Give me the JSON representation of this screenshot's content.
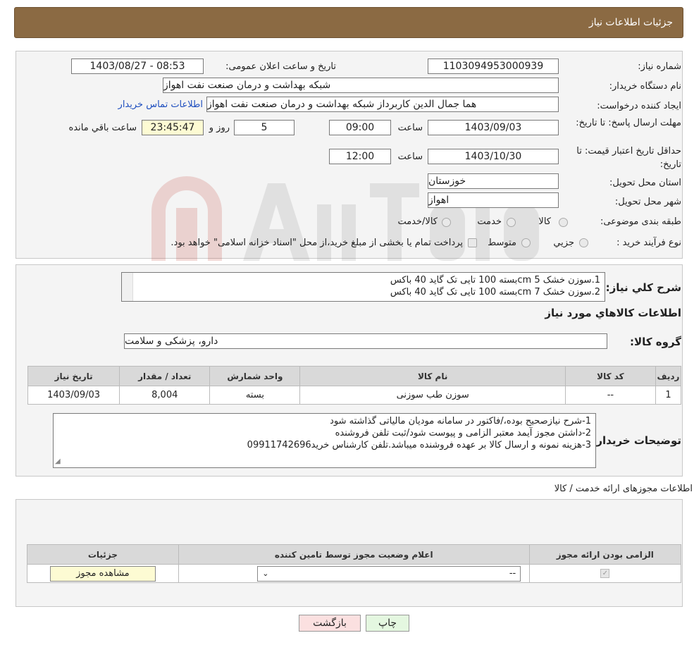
{
  "header": {
    "title": "جزئیات اطلاعات نیاز"
  },
  "info": {
    "need_number_label": "شماره نیاز:",
    "need_number": "1103094953000939",
    "announce_label": "تاریخ و ساعت اعلان عمومی:",
    "announce_value": "1403/08/27 - 08:53",
    "buyer_org_label": "نام دستگاه خریدار:",
    "buyer_org": "شبکه بهداشت و درمان صنعت نفت اهواز",
    "creator_label": "ایجاد کننده درخواست:",
    "creator": "هما جمال الدین کاربرداز شبکه بهداشت و درمان صنعت نفت اهواز",
    "contact_link": "اطلاعات تماس خریدار",
    "deadline_label": "مهلت ارسال پاسخ: تا تاریخ:",
    "deadline_date": "1403/09/03",
    "time_label": "ساعت",
    "deadline_time": "09:00",
    "days": "5",
    "days_label": "روز و",
    "remaining": "23:45:47",
    "remaining_label": "ساعت باقي مانده",
    "price_valid_label": "حداقل تاریخ اعتبار قیمت: تا تاریخ:",
    "price_valid_date": "1403/10/30",
    "price_valid_time": "12:00",
    "province_label": "استان محل تحویل:",
    "province": "خوزستان",
    "city_label": "شهر محل تحویل:",
    "city": "اهواز",
    "category_label": "طبقه بندی موضوعی:",
    "category_options": [
      "کالا",
      "خدمت",
      "کالا/خدمت"
    ],
    "process_label": "نوع فرآیند خرید :",
    "process_options": [
      "جزيي",
      "متوسط"
    ],
    "process_note": "پرداخت تمام یا بخشی از مبلغ خرید،از محل \"اسناد خزانه اسلامی\" خواهد بود."
  },
  "summary": {
    "label": "شرح کلي نياز:",
    "lines": [
      "1.سوزن خشک 5 cmبسته  100 تایی تک گاید 40 باکس",
      "2.سوزن خشک 7 cmبسته  100 تایی تک گاید 40 باکس"
    ],
    "goods_title": "اطلاعات کالاهاي مورد نياز",
    "group_label": "گروه کالا:",
    "group_value": "دارو، پزشکی و سلامت"
  },
  "goods_table": {
    "headers": [
      "رديف",
      "کد کالا",
      "نام کالا",
      "واحد شمارش",
      "تعداد / مقدار",
      "تاریخ نیاز"
    ],
    "rows": [
      [
        "1",
        "--",
        "سوزن طب سوزنی",
        "بسته",
        "8,004",
        "1403/09/03"
      ]
    ]
  },
  "buyer_notes": {
    "label": "توضیحات خریدار:",
    "lines": [
      "1-شرح نیازصحیح بوده،/فاکتور در سامانه مودیان مالیاتی گذاشته شود",
      "2-داشتن مجوز آیمد معتبر الزامی و پیوست شود/ثبت تلفن فروشنده",
      "3-هزینه  نمونه و ارسال کالا بر عهده فروشنده میباشد.تلفن کارشناس خرید09911742696"
    ]
  },
  "permits": {
    "title": "اطلاعات مجوزهای ارائه خدمت / کالا",
    "headers": [
      "الزامی بودن ارائه مجوز",
      "اعلام وضعیت مجوز توسط تامین کننده",
      "جزئیات"
    ],
    "select_value": "--",
    "view_button": "مشاهده مجوز"
  },
  "footer": {
    "print_button": "چاپ",
    "back_button": "بازگشت"
  },
  "colors": {
    "header_bg": "#8b6a43",
    "link": "#1f4fbf",
    "back_button_bg": "#fbe0e0",
    "print_button_bg": "#e4f7e0",
    "yellow_field": "#fdfbd3"
  }
}
